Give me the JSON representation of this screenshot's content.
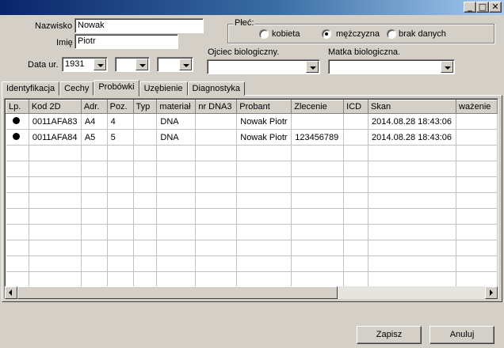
{
  "window": {
    "minimize_label": "_",
    "maximize_label": "□",
    "close_label": "✕"
  },
  "form": {
    "surname_label": "Nazwisko",
    "surname_value": "Nowak",
    "first_name_label": "Imię",
    "first_name_value": "Piotr",
    "birth_date_label": "Data ur.",
    "birth_year": "1931",
    "birth_month": "",
    "birth_day": "",
    "gender_label": "Płeć:",
    "gender_options": [
      "kobieta",
      "mężczyzna",
      "brak danych"
    ],
    "gender_selected": "mężczyzna",
    "father_label": "Ojciec biologiczny.",
    "father_value": "",
    "mother_label": "Matka biologiczna.",
    "mother_value": ""
  },
  "tabs": [
    "Identyfikacja",
    "Cechy",
    "Probówki",
    "Uzębienie",
    "Diagnostyka"
  ],
  "active_tab": "Probówki",
  "table": {
    "columns": [
      "Lp.",
      "Kod 2D",
      "Adr.",
      "Poz.",
      "Typ",
      "materiał",
      "nr DNA3",
      "Probant",
      "Zlecenie",
      "ICD",
      "Skan",
      "ważenie"
    ],
    "rows": [
      [
        "",
        "0011AFA83",
        "A4",
        "4",
        "",
        "DNA",
        "",
        "Nowak Piotr",
        "",
        "",
        "2014.08.28 18:43:06",
        ""
      ],
      [
        "",
        "0011AFA84",
        "A5",
        "5",
        "",
        "DNA",
        "",
        "Nowak Piotr",
        "123456789",
        "",
        "2014.08.28 18:43:06",
        ""
      ]
    ],
    "empty_rows": 10
  },
  "buttons": {
    "save": "Zapisz",
    "cancel": "Anuluj"
  }
}
